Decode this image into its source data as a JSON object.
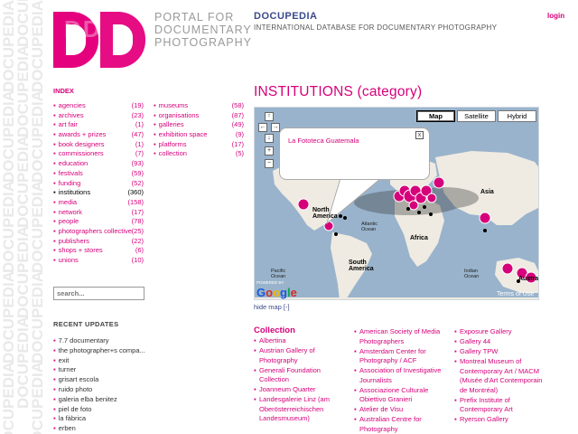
{
  "header": {
    "portal_text": [
      "PORTAL FOR",
      "DOCUMENTARY",
      "PHOTOGRAPHY"
    ],
    "title": "DOCUPEDIA",
    "subtitle": "INTERNATIONAL DATABASE FOR DOCUMENTARY PHOTOGRAPHY",
    "login": "login",
    "logo_text": "DD",
    "watermark": "DOCUPEDIA"
  },
  "sidebar": {
    "index_heading": "INDEX",
    "categories_col1": [
      {
        "label": "agencies",
        "count": "(19)"
      },
      {
        "label": "archives",
        "count": "(23)"
      },
      {
        "label": "art fair",
        "count": "(1)"
      },
      {
        "label": "awards + prizes",
        "count": "(47)"
      },
      {
        "label": "book designers",
        "count": "(1)"
      },
      {
        "label": "commissioners",
        "count": "(7)"
      },
      {
        "label": "education",
        "count": "(93)"
      },
      {
        "label": "festivals",
        "count": "(59)"
      },
      {
        "label": "funding",
        "count": "(52)"
      },
      {
        "label": "institutions",
        "count": "(360)",
        "active": true
      },
      {
        "label": "media",
        "count": "(158)"
      },
      {
        "label": "network",
        "count": "(17)"
      },
      {
        "label": "people",
        "count": "(78)"
      },
      {
        "label": "photographers collective",
        "count": "(25)"
      },
      {
        "label": "publishers",
        "count": "(22)"
      },
      {
        "label": "shops + stores",
        "count": "(6)"
      },
      {
        "label": "unions",
        "count": "(10)"
      }
    ],
    "categories_col2": [
      {
        "label": "museums",
        "count": "(58)"
      },
      {
        "label": "organisations",
        "count": "(87)"
      },
      {
        "label": "galleries",
        "count": "(49)"
      },
      {
        "label": "exhibition space",
        "count": "(9)"
      },
      {
        "label": "platforms",
        "count": "(17)"
      },
      {
        "label": "collection",
        "count": "(5)"
      }
    ],
    "search_placeholder": "search...",
    "recent_heading": "RECENT UPDATES",
    "recent_updates": [
      "7.7 documentary",
      "the photographer+s compa...",
      "exit",
      "turner",
      "grisart escola",
      "ruido photo",
      "galeria elba benitez",
      "piel de foto",
      "la fàbrica",
      "erben"
    ]
  },
  "main": {
    "page_title": "INSTITUTIONS (category)",
    "map": {
      "buttons": [
        "Map",
        "Satellite",
        "Hybrid"
      ],
      "selected": "Map",
      "popup_text": "La Fototeca Guatemala",
      "labels": {
        "north_america": [
          "North",
          "America"
        ],
        "atlantic": [
          "Atlantic",
          "Ocean"
        ],
        "africa": "Africa",
        "asia": "Asia",
        "south_america": [
          "South",
          "America"
        ],
        "pacific": [
          "Pacific",
          "Ocean"
        ],
        "indian": [
          "Indian",
          "Ocean"
        ],
        "australia": "Austra"
      },
      "powered_by": "POWERED BY",
      "google": "Google",
      "terms": "Terms of Use",
      "nav_symbols": [
        "↑",
        "←",
        "→",
        "↓",
        "+",
        "−"
      ],
      "close_symbol": "x",
      "colors": {
        "ocean": "#99b3cc",
        "land": "#efebe2",
        "marker": "#d6007a"
      }
    },
    "hide_map": "hide map [-]",
    "collection_heading": "Collection",
    "collection_col1": [
      "Albertina",
      "Austrian Gallery of Photography",
      "Generali Foundation Collection",
      "Joanneum Quarter",
      "Landesgalerie Linz (am Oberösterreichischen Landesmuseum)"
    ],
    "collection_col2": [
      "American Society of Media Photographers",
      "Amsterdam Center for Photography / ACF",
      "Association of Investigative Journalists",
      "Associazione Culturale Obiettivo Granieri",
      "Atelier de Visu",
      "Australian Centre for Photography"
    ],
    "collection_col3": [
      "Exposure Gallery",
      "Gallery 44",
      "Gallery TPW",
      "Montreal Museum of Contemporary Art / MACM (Musée d'Art Contemporain de Montréal)",
      "Prefix Institute of Contemporary Art",
      "Ryerson Gallery"
    ]
  },
  "bullet": "▪"
}
